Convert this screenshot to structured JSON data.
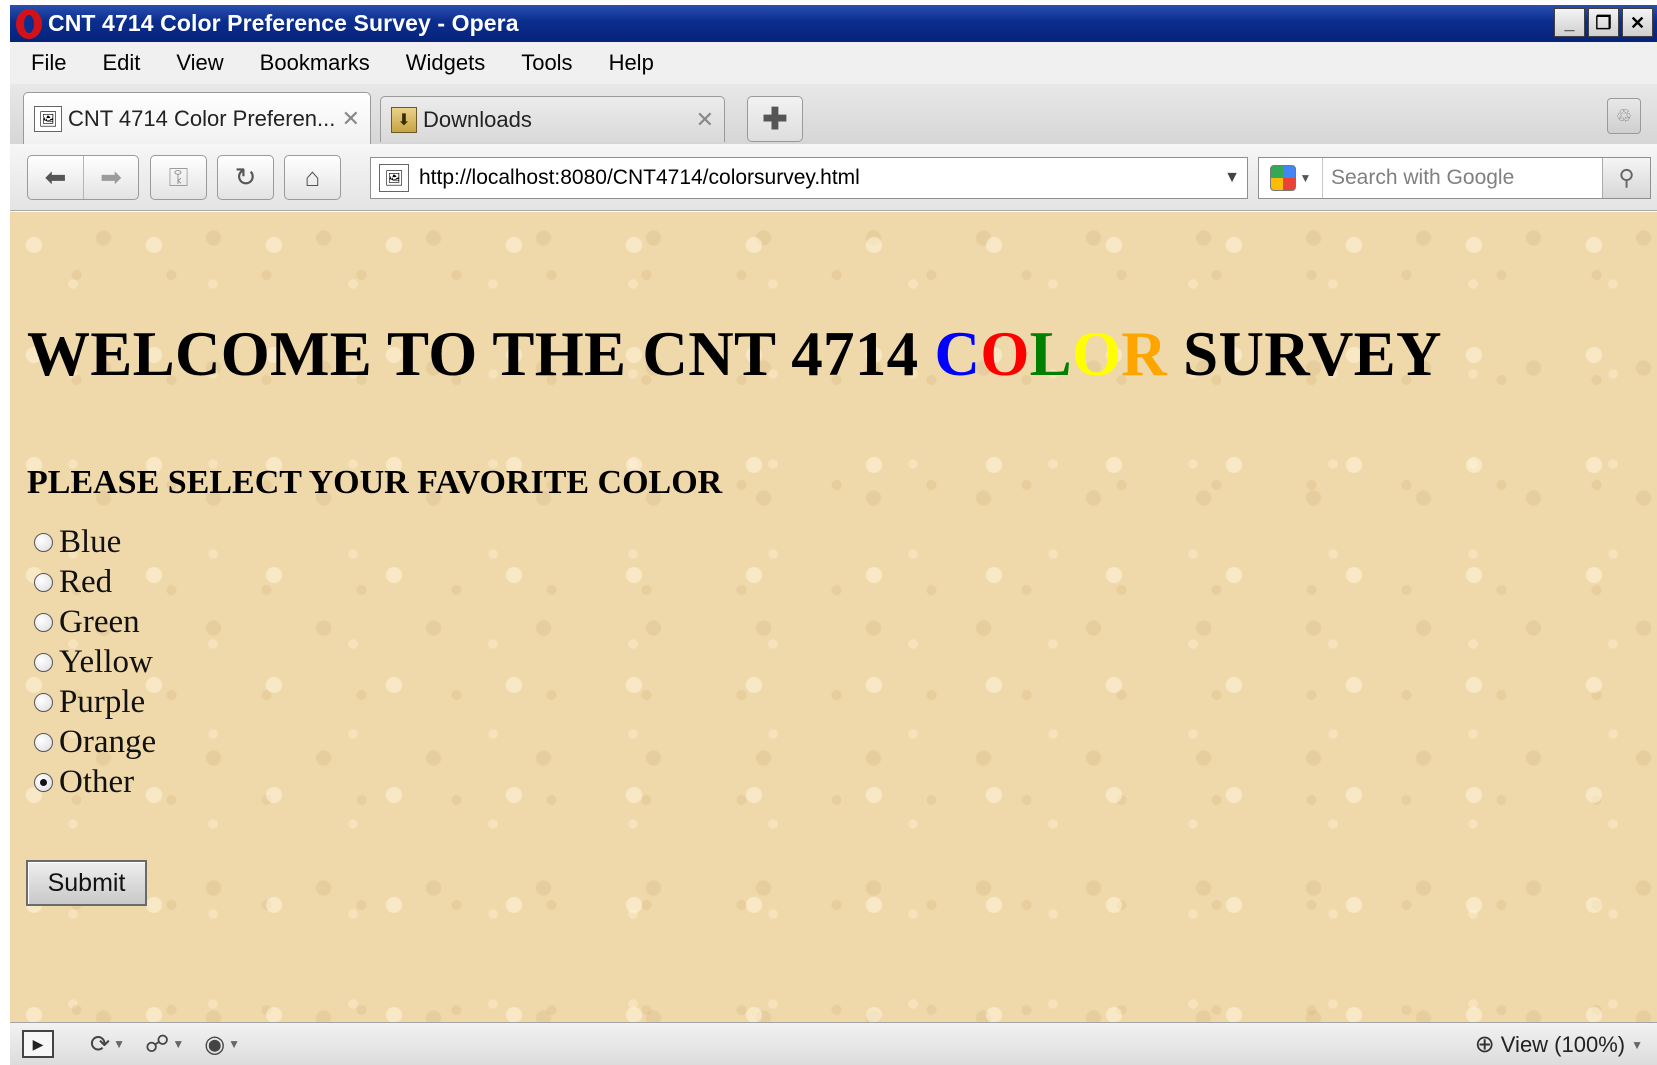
{
  "window": {
    "title": "CNT 4714 Color Preference Survey - Opera",
    "controls": {
      "minimize": "_",
      "maximize": "❐",
      "close": "✕"
    }
  },
  "menu": [
    "File",
    "Edit",
    "View",
    "Bookmarks",
    "Widgets",
    "Tools",
    "Help"
  ],
  "tabs": [
    {
      "label": "CNT 4714 Color Preferen...",
      "icon": "page-favicon",
      "active": true
    },
    {
      "label": "Downloads",
      "icon": "downloads-icon",
      "active": false
    }
  ],
  "tab_controls": {
    "close": "✕",
    "new_tab": "✚",
    "trash": "♲"
  },
  "nav": {
    "back": "⬅",
    "forward": "➡",
    "wand": "⚿",
    "reload": "↻",
    "home": "⌂",
    "url": "http://localhost:8080/CNT4714/colorsurvey.html",
    "dropdown": "▼",
    "search_placeholder": "Search with Google",
    "search_go": "⚲"
  },
  "page": {
    "heading_prefix": "WELCOME TO THE CNT 4714 ",
    "heading_color_word": [
      {
        "char": "C",
        "color": "#0000ff"
      },
      {
        "char": "O",
        "color": "#ff0000"
      },
      {
        "char": "L",
        "color": "#008000"
      },
      {
        "char": "O",
        "color": "#ffff00"
      },
      {
        "char": "R",
        "color": "#ffa500"
      }
    ],
    "heading_suffix": " SURVEY",
    "subheading": "PLEASE SELECT YOUR FAVORITE COLOR",
    "options": [
      {
        "label": "Blue",
        "checked": false
      },
      {
        "label": "Red",
        "checked": false
      },
      {
        "label": "Green",
        "checked": false
      },
      {
        "label": "Yellow",
        "checked": false
      },
      {
        "label": "Purple",
        "checked": false
      },
      {
        "label": "Orange",
        "checked": false
      },
      {
        "label": "Other",
        "checked": true
      }
    ],
    "submit_label": "Submit"
  },
  "status": {
    "panel_toggle": "▶",
    "icons": [
      "sync-icon",
      "network-icon",
      "turbo-icon"
    ],
    "zoom_label": "View (100%)"
  }
}
